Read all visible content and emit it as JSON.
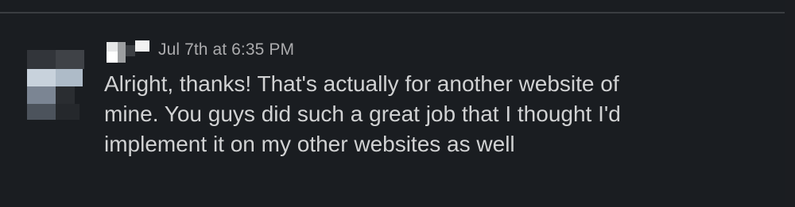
{
  "message": {
    "timestamp": "Jul 7th at 6:35 PM",
    "lines": [
      "Alright, thanks! That's actually for another website of",
      "mine. You guys did such a great job that I thought I'd",
      "implement it on my other websites as well"
    ]
  },
  "colors": {
    "background": "#1a1d21",
    "text": "#d1d2d3",
    "timestamp": "#ababad",
    "divider": "#3a3d41"
  }
}
